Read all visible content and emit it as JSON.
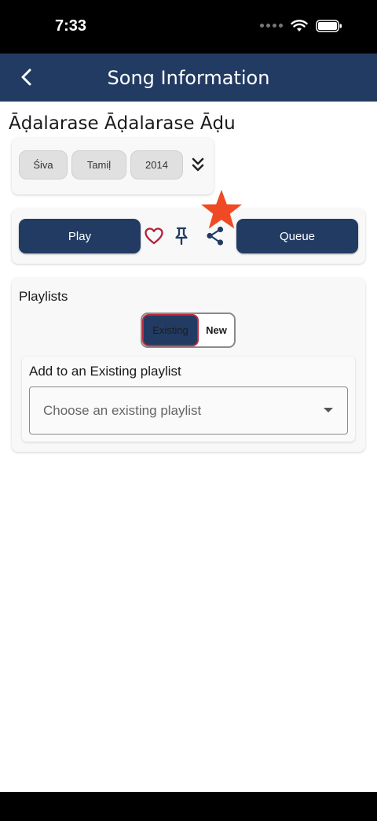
{
  "status_bar": {
    "time": "7:33"
  },
  "header": {
    "title": "Song Information"
  },
  "song": {
    "title": "Āḍalarase Āḍalarase Āḍu"
  },
  "tags": [
    "Śiva",
    "Tamiḷ",
    "2014"
  ],
  "actions": {
    "play_label": "Play",
    "queue_label": "Queue"
  },
  "playlists": {
    "heading": "Playlists",
    "segments": {
      "existing": "Existing",
      "new": "New"
    },
    "existing_label": "Add to an Existing playlist",
    "select_placeholder": "Choose an existing playlist"
  },
  "colors": {
    "primary": "#223b63",
    "accent_red": "#c0283c",
    "star": "#f04a24"
  }
}
